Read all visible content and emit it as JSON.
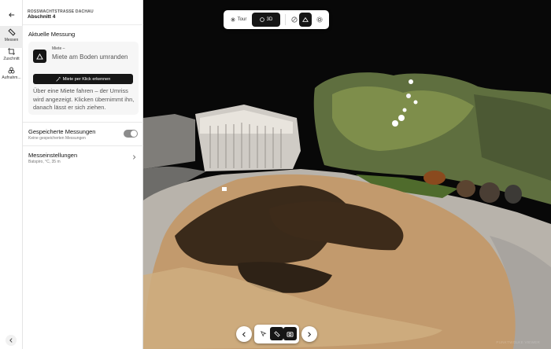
{
  "header": {
    "project": "ROSSWACHTSTRASSE DACHAU",
    "section": "Abschnitt 4"
  },
  "rail": {
    "items": [
      {
        "label": "Messen",
        "icon": "ruler-icon",
        "active": true
      },
      {
        "label": "Zuschnitt",
        "icon": "crop-icon",
        "active": false
      },
      {
        "label": "Aufnahm...",
        "icon": "capture-icon",
        "active": false
      }
    ]
  },
  "measure": {
    "heading": "Aktuelle Messung",
    "card": {
      "kicker": "Miete –",
      "text": "Miete am Boden umranden",
      "detect_label": "Miete per Klick erkennen",
      "description": "Über eine Miete fahren – der Umriss wird angezeigt. Klicken übernimmt ihn, danach lässt er sich ziehen."
    }
  },
  "saved": {
    "title": "Gespeicherte Messungen",
    "subtitle": "Keine gespeicherten Messungen",
    "toggle_on": true
  },
  "settings": {
    "title": "Messeinstellungen",
    "subtitle": "Batspiro, °C, 35 m"
  },
  "viewer": {
    "tour_label": "Tour",
    "mode_label": "3D",
    "watermark": "PUNKTWOLKE VIEWER"
  },
  "colors": {
    "accent": "#161616",
    "panel_bg": "#ffffff",
    "card_bg": "#f6f6f6"
  }
}
